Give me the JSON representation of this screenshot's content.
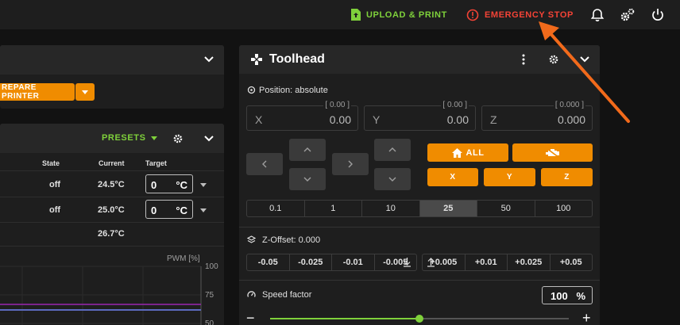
{
  "topbar": {
    "upload_label": "UPLOAD & PRINT",
    "estop_label": "EMERGENCY STOP",
    "accent_green": "#7fd13b",
    "accent_red": "#f44336"
  },
  "left_top": {
    "prepare_label": "REPARE PRINTER"
  },
  "temps": {
    "presets_label": "PRESETS",
    "columns": {
      "state": "State",
      "current": "Current",
      "target": "Target"
    },
    "rows": [
      {
        "state": "off",
        "current": "24.5°C",
        "target_value": "0",
        "unit": "°C"
      },
      {
        "state": "off",
        "current": "25.0°C",
        "target_value": "0",
        "unit": "°C"
      },
      {
        "state": "",
        "current": "26.7°C"
      }
    ],
    "chart": {
      "pwm_label": "PWM [%]",
      "ticks": [
        "100",
        "75",
        "50"
      ]
    }
  },
  "toolhead": {
    "title": "Toolhead",
    "position_label": "Position: absolute",
    "axes": [
      {
        "label": "X",
        "value": "0.00",
        "min": "[ 0.00 ]"
      },
      {
        "label": "Y",
        "value": "0.00",
        "min": "[ 0.00 ]"
      },
      {
        "label": "Z",
        "value": "0.000",
        "min": "[ 0.000 ]"
      }
    ],
    "home_all_label": "ALL",
    "home_x": "X",
    "home_y": "Y",
    "home_z": "Z",
    "steps": [
      "0.1",
      "1",
      "10",
      "25",
      "50",
      "100"
    ],
    "active_step": "25",
    "zoffset_label": "Z-Offset: 0.000",
    "zoffset_minus": [
      "-0.05",
      "-0.025",
      "-0.01",
      "-0.005"
    ],
    "zoffset_plus": [
      "+0.005",
      "+0.01",
      "+0.025",
      "+0.05"
    ],
    "speed_label": "Speed factor",
    "speed_value": "100",
    "speed_unit": "%",
    "speed_fraction": 0.5
  }
}
